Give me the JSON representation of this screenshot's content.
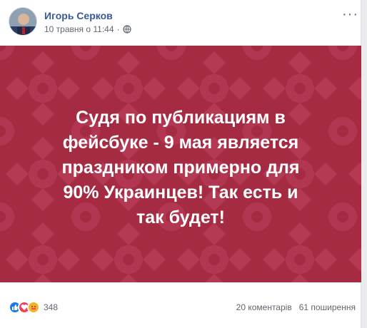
{
  "post": {
    "author": "Игорь Серков",
    "timestamp": "10 травня о 11:44",
    "separator": "·",
    "privacy_icon": "globe-icon",
    "more_icon": "more-options-icon",
    "more_glyph": "···"
  },
  "image": {
    "background_color": "#a52b43",
    "text": "Судя по публикациям в\nфейсбуке - 9 мая является\nпраздником примерно для\n90% Украинцев! Так есть и\nтак будет!"
  },
  "footer": {
    "reactions": [
      "like-icon",
      "love-icon",
      "care-icon"
    ],
    "reaction_count": "348",
    "comments": "20 коментарів",
    "shares": "61 поширення"
  }
}
